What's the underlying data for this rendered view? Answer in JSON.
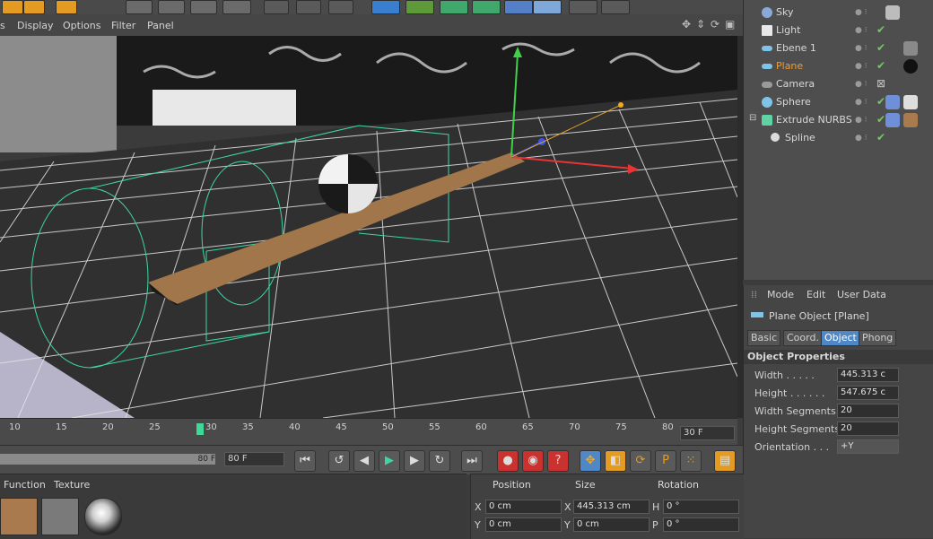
{
  "viewport_menu": [
    "s",
    "Display",
    "Options",
    "Filter",
    "Panel"
  ],
  "objects": [
    {
      "label": "Sky",
      "icon_color": "#8aa9d8",
      "selected": false
    },
    {
      "label": "Light",
      "icon_color": "#e8e8e8",
      "selected": false
    },
    {
      "label": "Ebene 1",
      "icon_color": "#7fc4e6",
      "selected": false
    },
    {
      "label": "Plane",
      "icon_color": "#7fc4e6",
      "selected": true
    },
    {
      "label": "Camera",
      "icon_color": "#9a9a9a",
      "selected": false
    },
    {
      "label": "Sphere",
      "icon_color": "#7fc4e6",
      "selected": false
    },
    {
      "label": "Extrude NURBS",
      "icon_color": "#5fd3a5",
      "selected": false
    },
    {
      "label": "Spline",
      "icon_color": "#dcdcdc",
      "selected": false
    }
  ],
  "attributes": {
    "menu": [
      "Mode",
      "Edit",
      "User Data"
    ],
    "object_title": "Plane Object [Plane]",
    "tabs": [
      "Basic",
      "Coord.",
      "Object",
      "Phong"
    ],
    "active_tab": "Object",
    "section": "Object Properties",
    "rows": [
      {
        "label": "Width . . . . .",
        "value": "445.313 c"
      },
      {
        "label": "Height . . . . . .",
        "value": "547.675 c"
      },
      {
        "label": "Width Segments",
        "value": "20"
      },
      {
        "label": "Height Segments",
        "value": "20"
      },
      {
        "label": "Orientation . . .",
        "value": "+Y"
      }
    ]
  },
  "timeline": {
    "ticks": [
      "10",
      "15",
      "20",
      "25",
      "30",
      "35",
      "40",
      "45",
      "50",
      "55",
      "60",
      "65",
      "70",
      "75",
      "80"
    ],
    "current_frame": "30",
    "frame_field": "30 F",
    "end_field": "80 F",
    "end_field_2": "80 F"
  },
  "material_menu": [
    "Function",
    "Texture"
  ],
  "coordinates": {
    "headers": [
      "Position",
      "Size",
      "Rotation"
    ],
    "rows": [
      {
        "axis": "X",
        "pos": "0 cm",
        "saxis": "X",
        "size": "445.313 cm",
        "raxis": "H",
        "rot": "0 °"
      },
      {
        "axis": "Y",
        "pos": "0 cm",
        "saxis": "Y",
        "size": "0 cm",
        "raxis": "P",
        "rot": "0 °"
      }
    ]
  },
  "colors": {
    "selected_object": "#f29a2e",
    "active_tab": "#4f87c7",
    "grid": "#e4e4e4"
  }
}
